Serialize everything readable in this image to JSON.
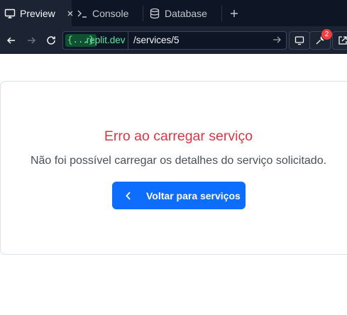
{
  "tabs": [
    {
      "label": "Preview",
      "icon": "monitor-icon",
      "active": true,
      "closable": true
    },
    {
      "label": "Console",
      "icon": "terminal-icon",
      "active": false
    },
    {
      "label": "Database",
      "icon": "database-icon",
      "active": false
    }
  ],
  "address_bar": {
    "domain_badge": "{...}",
    "domain": ".replit.dev",
    "path": "/services/5",
    "devtools_badge_count": "2"
  },
  "error": {
    "title": "Erro ao carregar serviço",
    "message": "Não foi possível carregar os detalhes do serviço solicitado.",
    "back_button_label": "Voltar para serviços"
  },
  "colors": {
    "error_title": "#dc3545",
    "primary_button": "#0d6efd",
    "tab_bar_bg": "#0e1525",
    "domain_green": "#5fe3a1",
    "badge_red": "#f23f42"
  }
}
